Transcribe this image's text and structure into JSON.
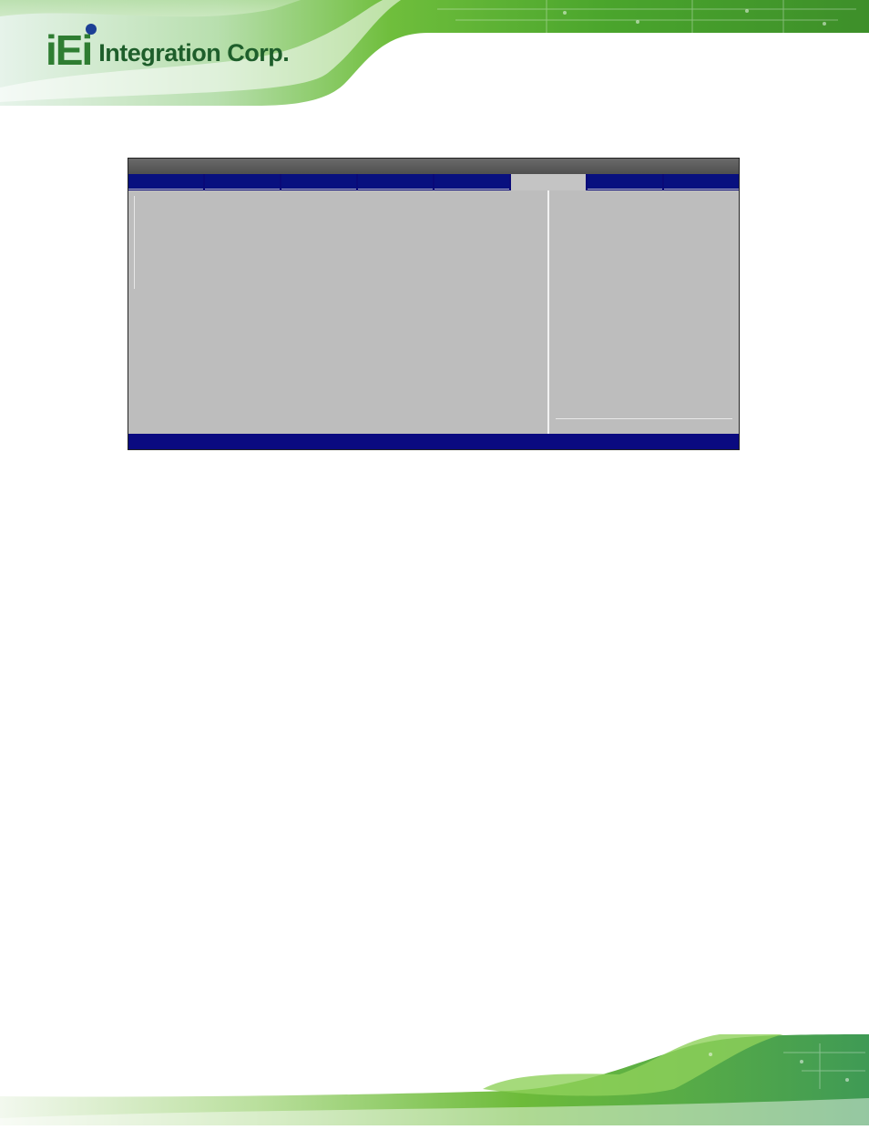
{
  "header": {
    "logo_mark": "iEi",
    "logo_text": "Integration Corp."
  },
  "colors": {
    "banner_green": "#5fae2e",
    "bios_blue": "#0a0a80",
    "bios_gray": "#bdbdbd"
  },
  "bios": {
    "title": "",
    "tabs": [
      {
        "label": ""
      },
      {
        "label": ""
      },
      {
        "label": ""
      },
      {
        "label": ""
      },
      {
        "label": ""
      },
      {
        "label": ""
      },
      {
        "label": ""
      },
      {
        "label": ""
      }
    ],
    "active_tab_index": 5,
    "status": ""
  }
}
